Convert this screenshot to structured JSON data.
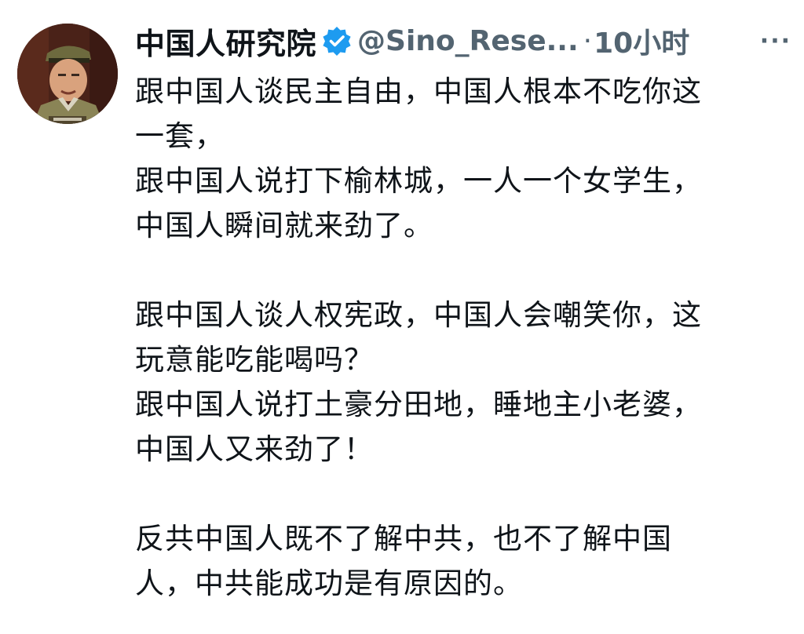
{
  "tweet": {
    "author_name": "中国人研究院",
    "handle": "@Sino_Rese...",
    "separator": "·",
    "timestamp": "10小时",
    "more_label": "···",
    "avatar_icon": "profile-photo",
    "verified_icon": "verified-badge-icon",
    "verified_color": "#1d9bf0",
    "text_lines": [
      "跟中国人谈民主自由，中国人根本不吃你这",
      "一套，",
      "跟中国人说打下榆林城，一人一个女学生，",
      "中国人瞬间就来劲了。",
      "",
      "跟中国人谈人权宪政，中国人会嘲笑你，这",
      "玩意能吃能喝吗？",
      "跟中国人说打土豪分田地，睡地主小老婆，",
      "中国人又来劲了！",
      "",
      "反共中国人既不了解中共，也不了解中国",
      "人，中共能成功是有原因的。"
    ]
  }
}
